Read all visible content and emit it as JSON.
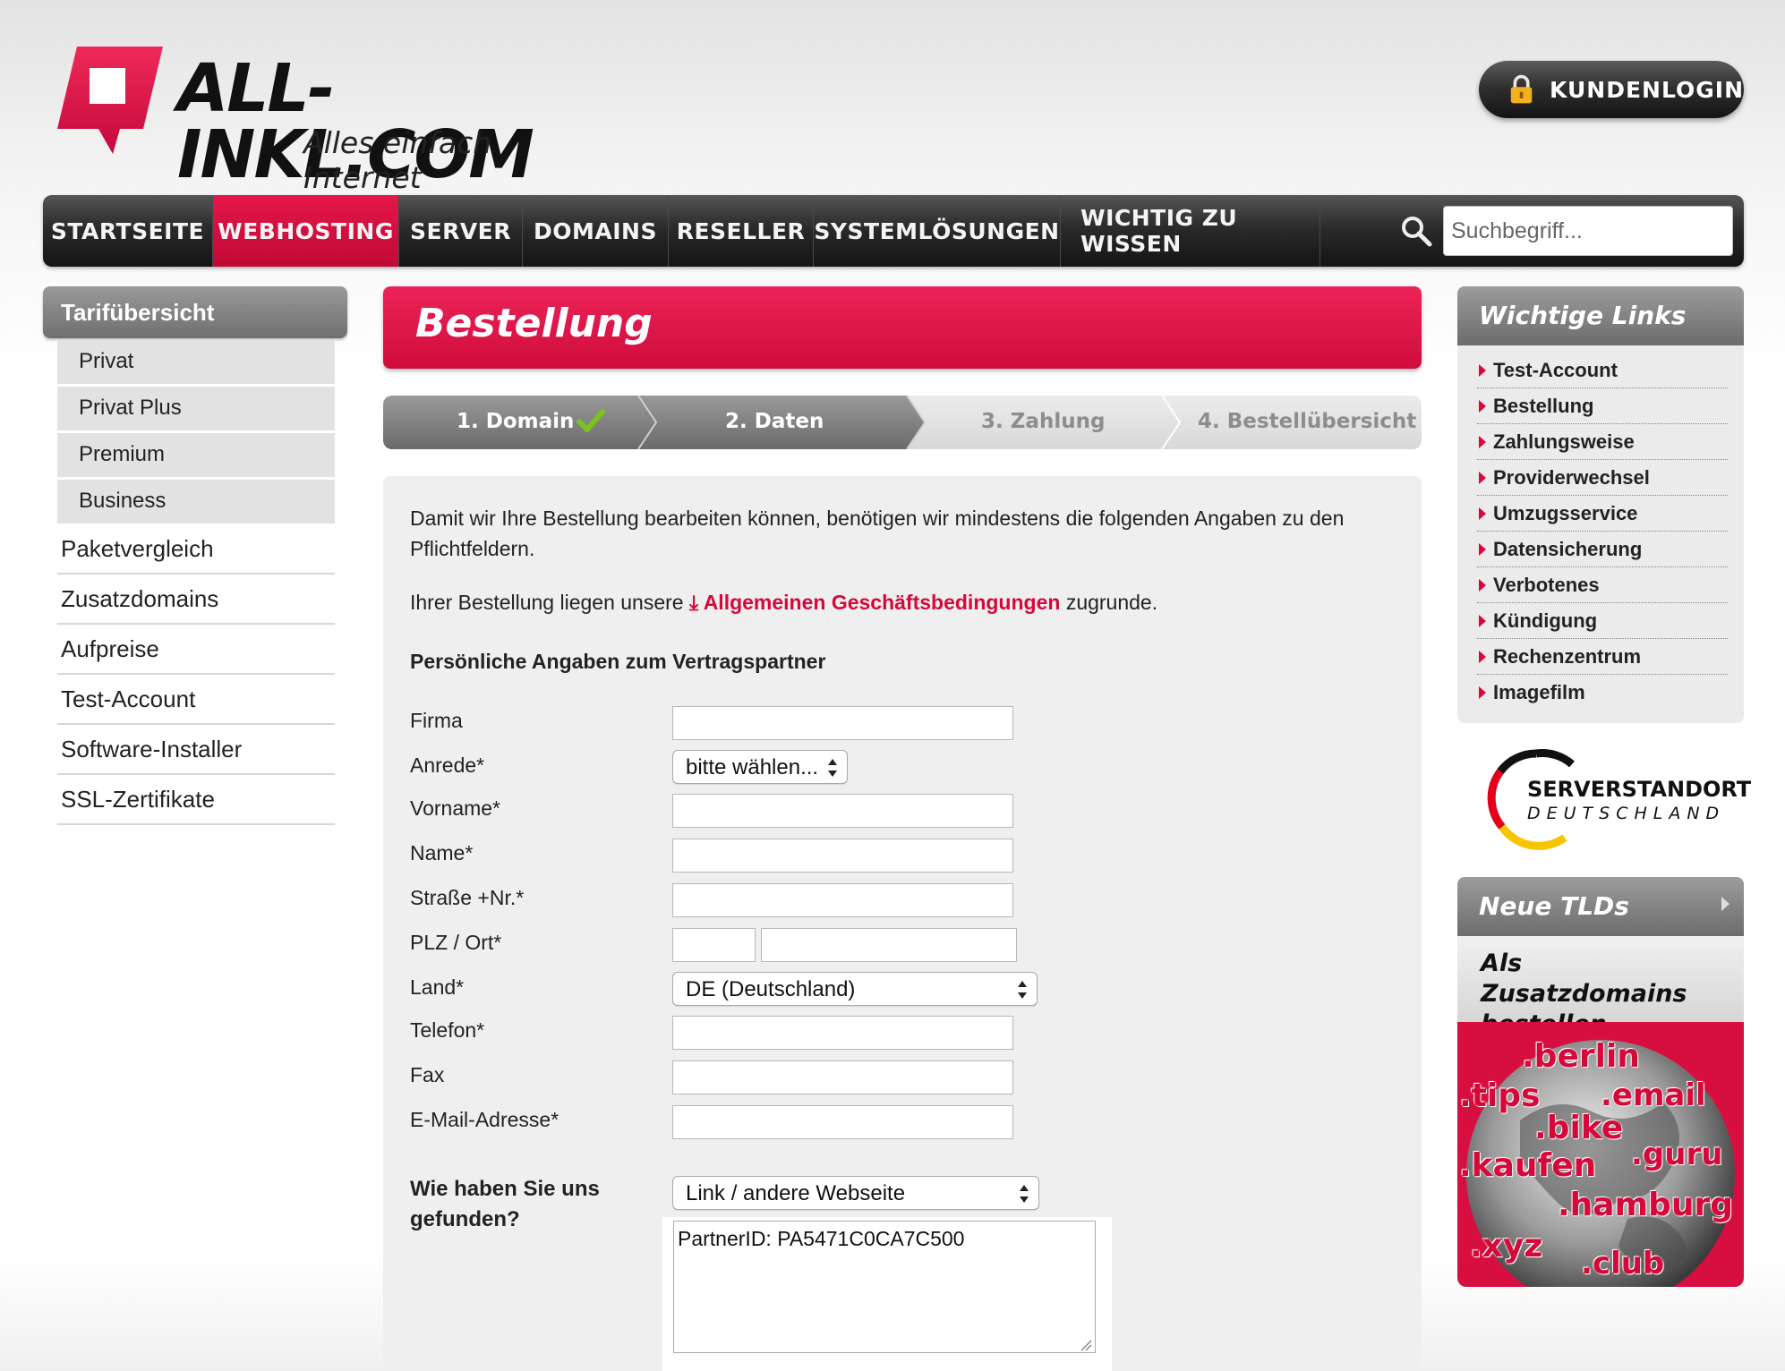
{
  "header": {
    "brand": "ALL-INKL.COM",
    "slogan": "Alles einfach Internet",
    "login_label": "KUNDENLOGIN"
  },
  "nav": {
    "items": [
      "STARTSEITE",
      "WEBHOSTING",
      "SERVER",
      "DOMAINS",
      "RESELLER",
      "SYSTEMLÖSUNGEN",
      "WICHTIG ZU WISSEN"
    ],
    "active": "WEBHOSTING",
    "search_placeholder": "Suchbegriff..."
  },
  "sidebar": {
    "heading": "Tarifübersicht",
    "sub_items": [
      "Privat",
      "Privat Plus",
      "Premium",
      "Business"
    ],
    "items": [
      "Paketvergleich",
      "Zusatzdomains",
      "Aufpreise",
      "Test-Account",
      "Software-Installer",
      "SSL-Zertifikate"
    ]
  },
  "main": {
    "title": "Bestellung",
    "steps": [
      "1. Domain",
      "2. Daten",
      "3. Zahlung",
      "4. Bestellübersicht"
    ],
    "intro": "Damit wir Ihre Bestellung bearbeiten können, benötigen wir mindestens die folgenden Angaben zu den Pflichtfeldern.",
    "agb_prefix": "Ihrer Bestellung liegen unsere",
    "agb_link": "Allgemeinen Geschäftsbedingungen",
    "agb_suffix": "zugrunde.",
    "section_title": "Persönliche Angaben zum Vertragspartner",
    "fields": {
      "firma": "Firma",
      "anrede": "Anrede*",
      "vorname": "Vorname*",
      "name": "Name*",
      "strasse": "Straße +Nr.*",
      "plz_ort": "PLZ / Ort*",
      "land": "Land*",
      "telefon": "Telefon*",
      "fax": "Fax",
      "email": "E-Mail-Adresse*"
    },
    "anrede_value": "bitte wählen...",
    "land_value": "DE (Deutschland)",
    "found_label": "Wie haben Sie uns gefunden?",
    "found_value": "Link / andere Webseite",
    "partner_text": "PartnerID: PA5471C0CA7C500"
  },
  "right": {
    "links_heading": "Wichtige Links",
    "links": [
      "Test-Account",
      "Bestellung",
      "Zahlungsweise",
      "Providerwechsel",
      "Umzugsservice",
      "Datensicherung",
      "Verbotenes",
      "Kündigung",
      "Rechenzentrum",
      "Imagefilm"
    ],
    "badge_line1": "SERVERSTANDORT",
    "badge_line2": "DEUTSCHLAND",
    "tlds_heading": "Neue TLDs",
    "tlds_sub": "Als Zusatzdomains bestellen",
    "tlds": [
      ".berlin",
      ".tips",
      ".email",
      ".bike",
      ".kaufen",
      ".guru",
      ".hamburg",
      ".xyz",
      ".club"
    ]
  },
  "colors": {
    "brand_red": "#d6083a",
    "nav_dark": "#1c1c1c",
    "panel_bg": "#efefef"
  }
}
